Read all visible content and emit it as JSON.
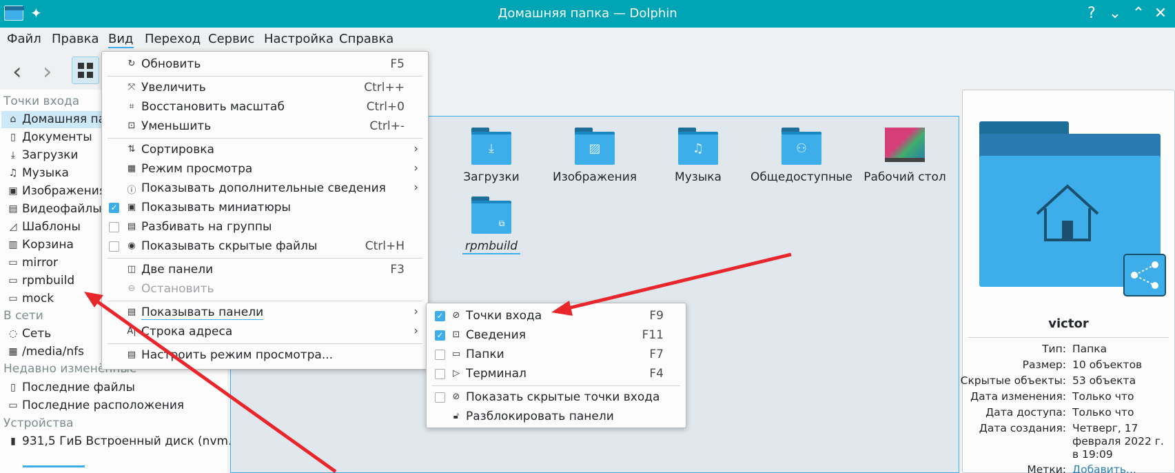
{
  "window": {
    "title": "Домашняя папка — Dolphin"
  },
  "colors": {
    "titlebar": "#00a5b5",
    "accent": "#3daee9",
    "folder": "#3daee9",
    "arrow": "#e8262c"
  },
  "menubar": [
    "Файл",
    "Правка",
    "Вид",
    "Переход",
    "Сервис",
    "Настройка",
    "Справка"
  ],
  "places": {
    "sections": {
      "entry": "Точки входа",
      "network": "В сети",
      "recent": "Недавно изменённые",
      "devices": "Устройства"
    },
    "items": [
      {
        "label": "Домашняя папка",
        "icon": "home-icon"
      },
      {
        "label": "Документы",
        "icon": "document-icon"
      },
      {
        "label": "Загрузки",
        "icon": "download-icon"
      },
      {
        "label": "Музыка",
        "icon": "music-icon"
      },
      {
        "label": "Изображения",
        "icon": "image-icon"
      },
      {
        "label": "Видеофайлы",
        "icon": "video-icon"
      },
      {
        "label": "Шаблоны",
        "icon": "template-icon"
      },
      {
        "label": "Корзина",
        "icon": "trash-icon"
      },
      {
        "label": "mirror",
        "icon": "folder-icon"
      },
      {
        "label": "rpmbuild",
        "icon": "folder-icon"
      },
      {
        "label": "mock",
        "icon": "folder-icon"
      }
    ],
    "network": [
      {
        "label": "Сеть"
      },
      {
        "label": "/media/nfs"
      }
    ],
    "recent": [
      {
        "label": "Последние файлы"
      },
      {
        "label": "Последние расположения"
      }
    ],
    "devices": [
      {
        "label": "931,5 ГиБ Встроенный диск (nvm..."
      }
    ]
  },
  "files": [
    {
      "name": "Загрузки",
      "icon": "download-icon"
    },
    {
      "name": "Изображения",
      "icon": "image-icon"
    },
    {
      "name": "Музыка",
      "icon": "music-icon"
    },
    {
      "name": "Общедоступные",
      "icon": "users-icon"
    },
    {
      "name": "Рабочий стол",
      "icon": "desktop-icon"
    },
    {
      "name": "rpmbuild",
      "icon": "folder-link-icon"
    }
  ],
  "view_menu": {
    "items": {
      "reload": {
        "label": "Обновить",
        "shortcut": "F5"
      },
      "zoom_in": {
        "label": "Увеличить",
        "shortcut": "Ctrl++"
      },
      "zoom_reset": {
        "label": "Восстановить масштаб",
        "shortcut": "Ctrl+0"
      },
      "zoom_out": {
        "label": "Уменьшить",
        "shortcut": "Ctrl+-"
      },
      "sort": {
        "label": "Сортировка"
      },
      "view_mode": {
        "label": "Режим просмотра"
      },
      "additional": {
        "label": "Показывать дополнительные сведения"
      },
      "previews": {
        "label": "Показывать миниатюры",
        "checked": true
      },
      "groups": {
        "label": "Разбивать на группы",
        "checked": false
      },
      "hidden": {
        "label": "Показывать скрытые файлы",
        "shortcut": "Ctrl+H",
        "checked": false
      },
      "split": {
        "label": "Две панели",
        "shortcut": "F3"
      },
      "stop": {
        "label": "Остановить"
      },
      "panels": {
        "label": "Показывать панели"
      },
      "location": {
        "label": "Строка адреса"
      },
      "configure": {
        "label": "Настроить режим просмотра..."
      }
    }
  },
  "panels_menu": {
    "items": {
      "places": {
        "label": "Точки входа",
        "shortcut": "F9",
        "checked": true
      },
      "info": {
        "label": "Сведения",
        "shortcut": "F11",
        "checked": true
      },
      "folders": {
        "label": "Папки",
        "shortcut": "F7",
        "checked": false
      },
      "terminal": {
        "label": "Терминал",
        "shortcut": "F4",
        "checked": false
      },
      "hidden_places": {
        "label": "Показать скрытые точки входа",
        "checked": false
      },
      "unlock": {
        "label": "Разблокировать панели"
      }
    }
  },
  "info_panel": {
    "name": "victor",
    "rows": [
      {
        "key": "Тип:",
        "value": "Папка"
      },
      {
        "key": "Размер:",
        "value": "10 объектов"
      },
      {
        "key": "Скрытые объекты:",
        "value": "53 объекта"
      },
      {
        "key": "Дата изменения:",
        "value": "Только что"
      },
      {
        "key": "Дата доступа:",
        "value": "Только что"
      },
      {
        "key": "Дата создания:",
        "value": "Четверг, 17 февраля 2022 г. в 19:09"
      },
      {
        "key": "Метки:",
        "value": "Добавить..."
      }
    ]
  }
}
